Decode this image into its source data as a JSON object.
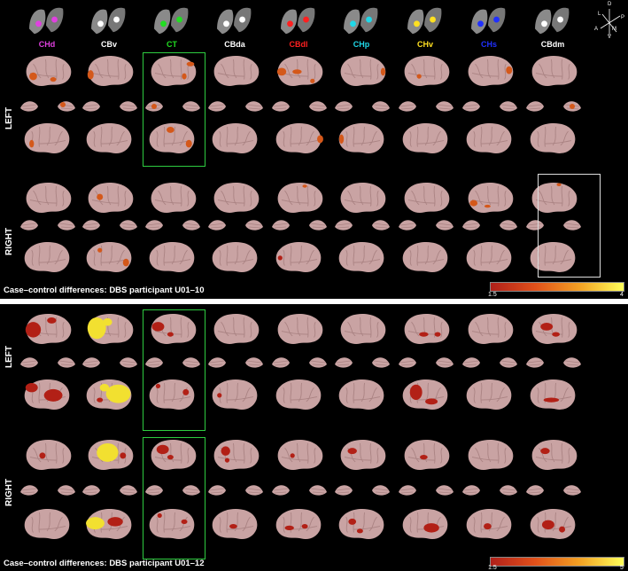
{
  "nuclei": [
    {
      "label": "CHd",
      "color": "#e040e0"
    },
    {
      "label": "CBv",
      "color": "#ffffff"
    },
    {
      "label": "CT",
      "color": "#22dd22"
    },
    {
      "label": "CBda",
      "color": "#ffffff"
    },
    {
      "label": "CBdl",
      "color": "#ff2020"
    },
    {
      "label": "CHp",
      "color": "#20d8e8"
    },
    {
      "label": "CHv",
      "color": "#ffe020"
    },
    {
      "label": "CHs",
      "color": "#2030ff"
    },
    {
      "label": "CBdm",
      "color": "#ffffff"
    }
  ],
  "axes_labels": {
    "d": "D",
    "l": "L",
    "p": "P",
    "a": "A",
    "m": "M",
    "v": "V"
  },
  "panel1": {
    "row_left": "LEFT",
    "row_right": "RIGHT",
    "caption": "Case–control differences: DBS  participant U01–10",
    "cbar_min": "1.5",
    "cbar_max": "4"
  },
  "panel2": {
    "row_left": "LEFT",
    "row_right": "RIGHT",
    "caption": "Case–control differences: DBS  participant U01–12",
    "cbar_min": "1.5",
    "cbar_max": "5"
  },
  "colors": {
    "brain": "#c9a3a3",
    "brain_shade": "#a98282",
    "blob_low": "#b22016",
    "blob_mid": "#d4581a",
    "blob_high": "#f2e030",
    "highlight": "#2ecc40",
    "highlight_alt": "#dddddd"
  }
}
